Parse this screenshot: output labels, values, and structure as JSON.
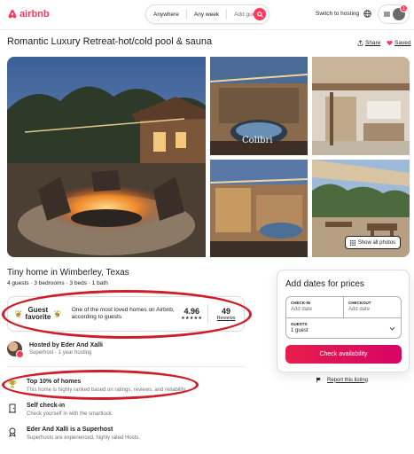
{
  "header": {
    "logo": "airbnb",
    "search": {
      "anywhere": "Anywhere",
      "any_week": "Any week",
      "add_guests": "Add guests"
    },
    "switch_hosting": "Switch to hosting",
    "notification_count": "1"
  },
  "listing": {
    "title": "Romantic Luxury Retreat-hot/cold pool & sauna",
    "share": "Share",
    "saved": "Saved"
  },
  "gallery": {
    "photo_caption": "Colibri",
    "show_all": "Show all photos"
  },
  "details": {
    "home_type": "Tiny home in Wimberley, Texas",
    "specs": "4 guests · 3 bedrooms · 3 beds · 1 bath"
  },
  "guest_favorite": {
    "badge": "Guest\nfavorite",
    "badge_line1": "Guest",
    "badge_line2": "favorite",
    "description": "One of the most loved homes on Airbnb, according to guests",
    "rating": "4.96",
    "stars": "★★★★★",
    "reviews_count": "49",
    "reviews_label": "Reviews"
  },
  "host": {
    "name": "Hosted by Eder And Xalli",
    "subtitle": "Superhost · 1 year hosting"
  },
  "highlights": [
    {
      "title": "Top 10% of homes",
      "subtitle": "This home is highly ranked based on ratings, reviews, and reliability.",
      "icon": "trophy-icon"
    },
    {
      "title": "Self check-in",
      "subtitle": "Check yourself in with the smartlock.",
      "icon": "door-icon"
    },
    {
      "title": "Eder And Xalli is a Superhost",
      "subtitle": "Superhosts are experienced, highly rated Hosts.",
      "icon": "medal-icon"
    }
  ],
  "booking": {
    "title": "Add dates for prices",
    "checkin_label": "CHECK-IN",
    "checkin_value": "Add date",
    "checkout_label": "CHECKOUT",
    "checkout_value": "Add date",
    "guests_label": "GUESTS",
    "guests_value": "1 guest",
    "button": "Check availability"
  },
  "report": "Report this listing",
  "colors": {
    "brand": "#ff385c",
    "annotation": "#cc1f2b"
  }
}
